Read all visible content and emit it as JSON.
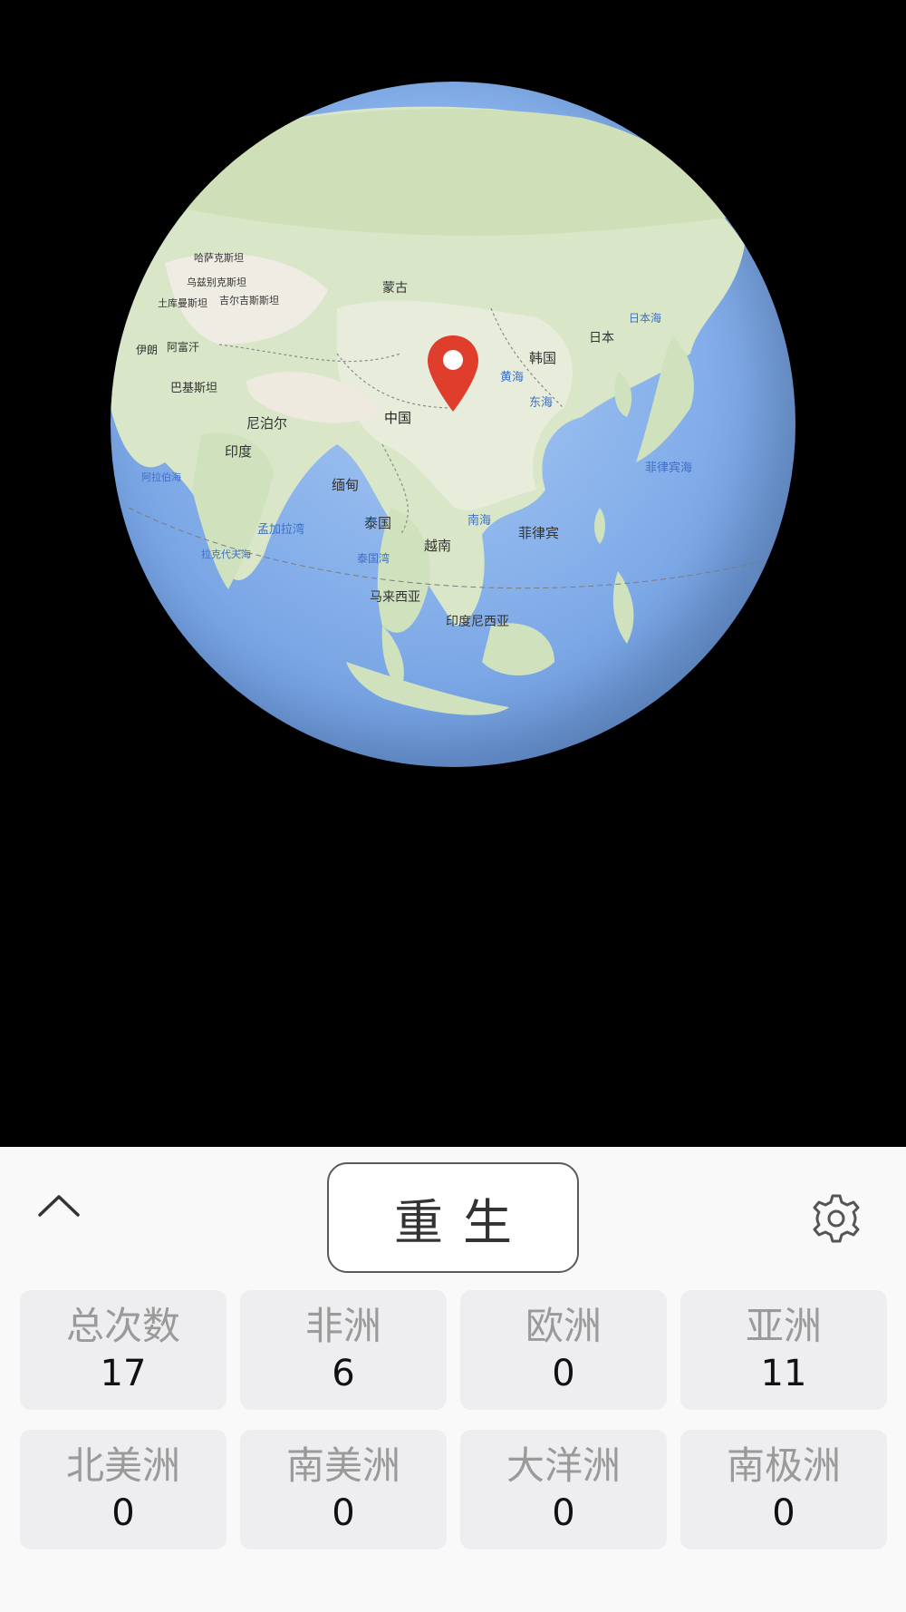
{
  "globe": {
    "ocean_color": "#86b0ea",
    "land_color": "#dfe9d2",
    "pin_color": "#e03e2d",
    "labels": {
      "mongolia": "蒙古",
      "china": "中国",
      "nepal": "尼泊尔",
      "india": "印度",
      "myanmar": "缅甸",
      "thailand": "泰国",
      "vietnam": "越南",
      "malaysia": "马来西亚",
      "indonesia": "印度尼西亚",
      "philippines": "菲律宾",
      "korea": "韩国",
      "japan": "日本",
      "kazakhstan": "哈萨克斯坦",
      "uzbekistan": "乌兹别克斯坦",
      "kyrgyzstan": "吉尔吉斯斯坦",
      "turkmenistan": "土库曼斯坦",
      "afghanistan": "阿富汗",
      "pakistan": "巴基斯坦",
      "iran": "伊朗",
      "bay_of_bengal": "孟加拉湾",
      "south_china_sea": "南海",
      "east_china_sea": "东海",
      "yellow_sea": "黄海",
      "sea_of_japan": "日本海",
      "philippine_sea": "菲律宾海",
      "gulf_of_thailand": "泰国湾",
      "arabian_sea": "阿拉伯海",
      "laccadive_sea": "拉克代夫海"
    }
  },
  "toolbar": {
    "collapse_icon": "chevron-up-icon",
    "reborn_label": "重生",
    "settings_icon": "gear-icon"
  },
  "stats": [
    {
      "label": "总次数",
      "value": "17"
    },
    {
      "label": "非洲",
      "value": "6"
    },
    {
      "label": "欧洲",
      "value": "0"
    },
    {
      "label": "亚洲",
      "value": "11"
    },
    {
      "label": "北美洲",
      "value": "0"
    },
    {
      "label": "南美洲",
      "value": "0"
    },
    {
      "label": "大洋洲",
      "value": "0"
    },
    {
      "label": "南极洲",
      "value": "0"
    }
  ]
}
